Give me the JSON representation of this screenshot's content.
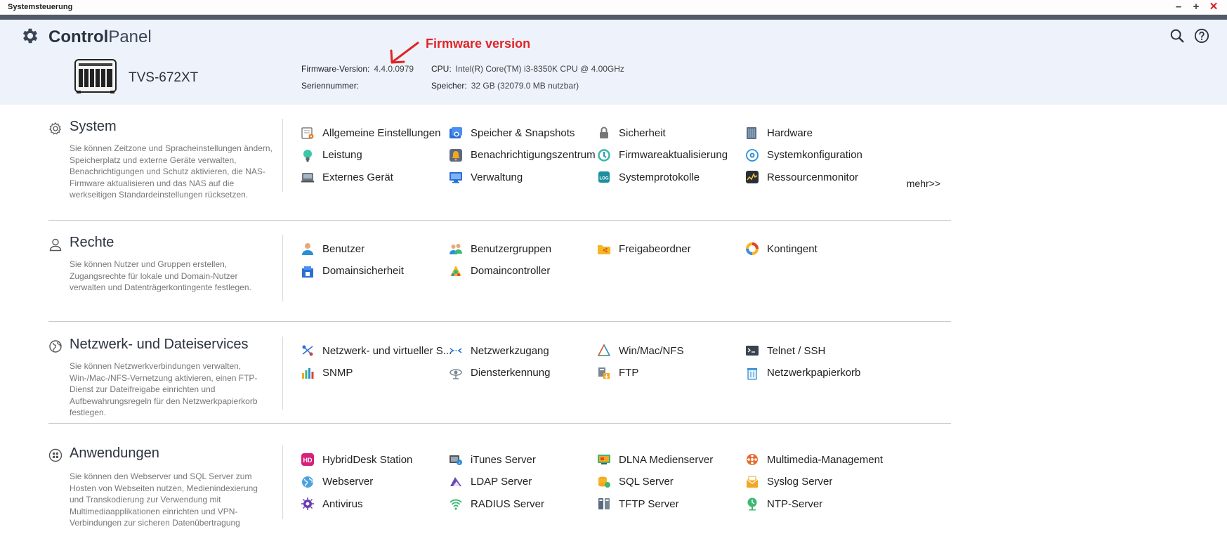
{
  "window": {
    "title": "Systemsteuerung",
    "minimize": "–",
    "maximize": "+",
    "close": "✕"
  },
  "app": {
    "title_bold": "Control",
    "title_light": "Panel"
  },
  "device": {
    "model": "TVS-672XT",
    "firmware_label": "Firmware-Version:",
    "firmware_value": "4.4.0.0979",
    "serial_label": "Seriennummer:",
    "serial_value": "",
    "cpu_label": "CPU:",
    "cpu_value": "Intel(R) Core(TM) i3-8350K CPU @ 4.00GHz",
    "memory_label": "Speicher:",
    "memory_value": "32 GB (32079.0 MB nutzbar)"
  },
  "annotation": {
    "text": "Firmware version",
    "color": "#e02424"
  },
  "colors": {
    "header_bg": "#eef2fb",
    "titlebar_strip": "#525a68",
    "close": "#d92121"
  },
  "sections": [
    {
      "title": "System",
      "icon": "gear-outline-icon",
      "description": "Sie können Zeitzone und Spracheinstellungen ändern, Speicherplatz und externe Geräte verwalten, Benachrichtigungen und Schutz aktivieren, die NAS-Firmware aktualisieren und das NAS auf die werkseitigen Standardeinstellungen rücksetzen.",
      "more": "mehr>>",
      "items": [
        {
          "label": "Allgemeine Einstellungen",
          "icon": "general-settings-icon"
        },
        {
          "label": "Speicher & Snapshots",
          "icon": "storage-snapshots-icon"
        },
        {
          "label": "Sicherheit",
          "icon": "lock-icon"
        },
        {
          "label": "Hardware",
          "icon": "hardware-icon"
        },
        {
          "label": "Leistung",
          "icon": "lightbulb-icon"
        },
        {
          "label": "Benachrichtigungszentrum",
          "icon": "notification-center-icon"
        },
        {
          "label": "Firmwareaktualisierung",
          "icon": "firmware-update-icon"
        },
        {
          "label": "Systemkonfiguration",
          "icon": "system-config-icon"
        },
        {
          "label": "Externes Gerät",
          "icon": "external-device-icon"
        },
        {
          "label": "Verwaltung",
          "icon": "monitor-icon"
        },
        {
          "label": "Systemprotokolle",
          "icon": "log-icon"
        },
        {
          "label": "Ressourcenmonitor",
          "icon": "resource-monitor-icon"
        }
      ]
    },
    {
      "title": "Rechte",
      "icon": "user-outline-icon",
      "description": "Sie können Nutzer und Gruppen erstellen, Zugangsrechte für lokale und Domain-Nutzer verwalten und Datenträgerkontingente festlegen.",
      "items": [
        {
          "label": "Benutzer",
          "icon": "user-icon"
        },
        {
          "label": "Benutzergruppen",
          "icon": "user-group-icon"
        },
        {
          "label": "Freigabeordner",
          "icon": "shared-folder-icon"
        },
        {
          "label": "Kontingent",
          "icon": "quota-icon"
        },
        {
          "label": "Domainsicherheit",
          "icon": "domain-security-icon"
        },
        {
          "label": "Domaincontroller",
          "icon": "domain-controller-icon"
        }
      ]
    },
    {
      "title": "Netzwerk- und Dateiservices",
      "icon": "globe-outline-icon",
      "description": "Sie können Netzwerkverbindungen verwalten, Win-/Mac-/NFS-Vernetzung aktivieren, einen FTP-Dienst zur Dateifreigabe einrichten und Aufbewahrungsregeln für den Netzwerkpapierkorb festlegen.",
      "items": [
        {
          "label": "Netzwerk- und virtueller S...",
          "icon": "network-switch-icon"
        },
        {
          "label": "Netzwerkzugang",
          "icon": "network-access-icon"
        },
        {
          "label": "Win/Mac/NFS",
          "icon": "win-mac-nfs-icon"
        },
        {
          "label": "Telnet / SSH",
          "icon": "terminal-icon"
        },
        {
          "label": "SNMP",
          "icon": "snmp-icon"
        },
        {
          "label": "Diensterkennung",
          "icon": "service-discovery-icon"
        },
        {
          "label": "FTP",
          "icon": "ftp-icon"
        },
        {
          "label": "Netzwerkpapierkorb",
          "icon": "recycle-bin-icon"
        }
      ]
    },
    {
      "title": "Anwendungen",
      "icon": "apps-outline-icon",
      "description": "Sie können den Webserver und SQL Server zum Hosten von Webseiten nutzen, Medienindexierung und Transkodierung zur Verwendung mit Multimediaapplikationen einrichten und VPN-Verbindungen zur sicheren Datenübertragung",
      "items": [
        {
          "label": "HybridDesk Station",
          "icon": "hybriddesk-icon"
        },
        {
          "label": "iTunes Server",
          "icon": "itunes-server-icon"
        },
        {
          "label": "DLNA Medienserver",
          "icon": "dlna-icon"
        },
        {
          "label": "Multimedia-Management",
          "icon": "multimedia-icon"
        },
        {
          "label": "Webserver",
          "icon": "webserver-icon"
        },
        {
          "label": "LDAP Server",
          "icon": "ldap-icon"
        },
        {
          "label": "SQL Server",
          "icon": "sql-server-icon"
        },
        {
          "label": "Syslog Server",
          "icon": "syslog-icon"
        },
        {
          "label": "Antivirus",
          "icon": "antivirus-icon"
        },
        {
          "label": "RADIUS Server",
          "icon": "radius-icon"
        },
        {
          "label": "TFTP Server",
          "icon": "tftp-icon"
        },
        {
          "label": "NTP-Server",
          "icon": "ntp-icon"
        }
      ]
    }
  ]
}
